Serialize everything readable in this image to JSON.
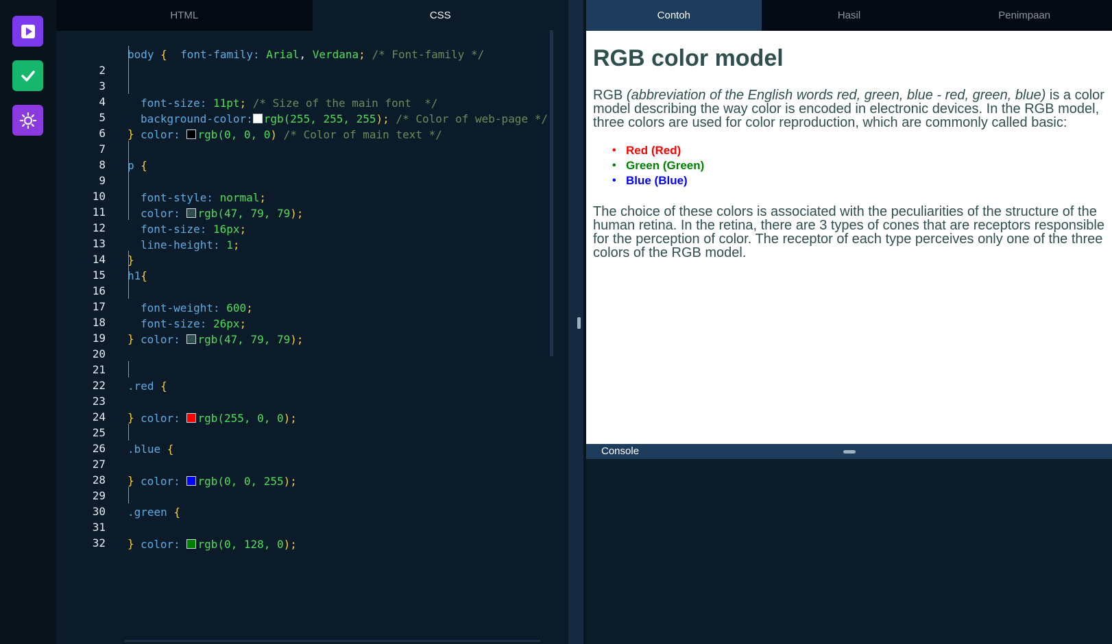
{
  "rail": {
    "run_icon": "play-icon",
    "check_icon": "check-icon",
    "settings_icon": "sun-icon",
    "colors": {
      "run": "#7c3aed",
      "check": "#16b66c",
      "settings": "#8b3ae0"
    }
  },
  "editor_tabs": [
    {
      "label": "HTML",
      "active": false
    },
    {
      "label": "CSS",
      "active": true
    }
  ],
  "code": {
    "line1_sel": "body ",
    "line1_open": "{",
    "line1_prop": "  font-family:",
    "line1_val": " Arial",
    "line1_comma": ",",
    "line1_val2": " Verdana",
    "line1_semi": ";",
    "line1_cmt": " /* Font-family */",
    "line2_num": "2",
    "line2_prop": "font-size:",
    "line2_val": " 11pt",
    "line2_semi": ";",
    "line2_cmt": " /* Size of the main font  */",
    "line3_num": "3",
    "line3_prop": "background-color:",
    "line3_fn": "rgb(",
    "line3_args": "255, 255, 255",
    "line3_close": ");",
    "line3_cmt": " /* Color of web-page */",
    "line4_num": "4",
    "line4_prop": "color: ",
    "line4_fn": "rgb(",
    "line4_args": "0, 0, 0",
    "line4_close": ")",
    "line4_cmt": " /* Color of main text */",
    "line5_num": "5",
    "line5_brace": "}",
    "line6_num": "6",
    "line7_num": "7",
    "line7_sel": "p ",
    "line7_open": "{",
    "line8_num": "8",
    "line8_prop": "font-style:",
    "line8_val": " normal",
    "line8_semi": ";",
    "line9_num": "9",
    "line9_prop": "color: ",
    "line9_fn": "rgb(",
    "line9_args": "47, 79, 79",
    "line9_close": ");",
    "line10_num": "10",
    "line10_prop": "font-size:",
    "line10_val": " 16px",
    "line10_semi": ";",
    "line11_num": "11",
    "line11_prop": "line-height:",
    "line11_val": " 1",
    "line11_semi": ";",
    "line12_num": "12",
    "line13_num": "13",
    "line13_brace": "}",
    "line14_num": "14",
    "line14_sel": "h1",
    "line14_open": "{",
    "line15_num": "15",
    "line15_prop": "font-weight:",
    "line15_val": " 600",
    "line15_semi": ";",
    "line16_num": "16",
    "line16_prop": "font-size:",
    "line16_val": " 26px",
    "line16_semi": ";",
    "line17_num": "17",
    "line17_prop": "color: ",
    "line17_fn": "rgb(",
    "line17_args": "47, 79, 79",
    "line17_close": ");",
    "line18_num": "18",
    "line18_brace": "}",
    "line19_num": "19",
    "line20_num": "20",
    "line21_num": "21",
    "line21_sel": ".red ",
    "line21_open": "{",
    "line22_num": "22",
    "line22_prop": "color: ",
    "line22_fn": "rgb(",
    "line22_args": "255, 0, 0",
    "line22_close": ");",
    "line23_num": "23",
    "line23_brace": "}",
    "line24_num": "24",
    "line25_num": "25",
    "line25_sel": ".blue ",
    "line25_open": "{",
    "line26_num": "26",
    "line26_prop": "color: ",
    "line26_fn": "rgb(",
    "line26_args": "0, 0, 255",
    "line26_close": ");",
    "line27_num": "27",
    "line27_brace": "}",
    "line28_num": "28",
    "line29_num": "29",
    "line29_sel": ".green ",
    "line29_open": "{",
    "line30_num": "30",
    "line30_prop": "color: ",
    "line30_fn": "rgb(",
    "line30_args": "0, 128, 0",
    "line30_close": ");",
    "line31_num": "31",
    "line31_brace": "}",
    "line32_num": "32",
    "swatches": {
      "white": "#ffffff",
      "black": "#000000",
      "slate": "#2f4f4f",
      "red": "#ff0000",
      "blue": "#0000ff",
      "green": "#008000"
    }
  },
  "preview_tabs": [
    {
      "label": "Contoh",
      "active": true
    },
    {
      "label": "Hasil",
      "active": false
    },
    {
      "label": "Penimpaan",
      "active": false
    }
  ],
  "preview": {
    "heading": "RGB color model",
    "p1_start": "RGB ",
    "p1_em": "(abbreviation of the English words red, green, blue - red, green, blue)",
    "p1_end": " is a color model describing the way color is encoded in electronic devices. In the RGB model, three colors are used for color reproduction, which are commonly called basic:",
    "list": [
      "Red (Red)",
      "Green (Green)",
      "Blue (Blue)"
    ],
    "p2": "The choice of these colors is associated with the peculiarities of the structure of the human retina. In the retina, there are 3 types of cones that are receptors responsible for the perception of color. The receptor of each type perceives only one of the three colors of the RGB model."
  },
  "console": {
    "label": "Console"
  }
}
